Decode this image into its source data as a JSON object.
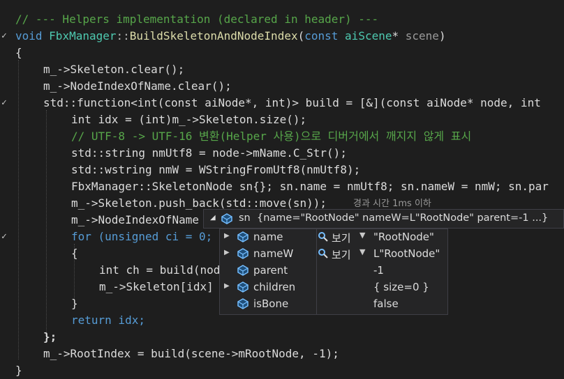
{
  "code": {
    "comment_helpers": "// --- Helpers implementation (declared in header) ---",
    "func_sig": {
      "void": "void",
      "cls": "FbxManager",
      "sep": "::",
      "fn": "BuildSkeletonAndNodeIndex",
      "p1": "(",
      "const": "const",
      "ty": "aiScene",
      "star": "*",
      "param": "scene",
      "p2": ")"
    },
    "lines": [
      "{",
      "m_->Skeleton.clear();",
      "m_->NodeIndexOfName.clear();",
      "std::function<int(const aiNode*, int)> build = [&](const aiNode* node, int",
      "int idx = (int)m_->Skeleton.size();",
      "// UTF-8 -> UTF-16 변환(Helper 사용)으로 디버거에서 깨지지 않게 표시",
      "std::string nmUtf8 = node->mName.C_Str();",
      "std::wstring nmW = WStringFromUtf8(nmUtf8);",
      "FbxManager::SkeletonNode sn{}; sn.name = nmUtf8; sn.nameW = nmW; sn.par",
      "m_->Skeleton.push_back(std::move(sn));",
      "m_->NodeIndexOfName",
      "for (unsigned ci = 0;",
      "{",
      "int ch = build(nod",
      "m_->Skeleton[idx]",
      "}",
      "return idx;",
      "};",
      "m_->RootIndex = build(scene->mRootNode, -1);",
      "}"
    ]
  },
  "perf_hint": "경과 시간 1ms 이하",
  "datatip": {
    "name": "sn",
    "value": "{name=\"RootNode\" nameW=L\"RootNode\" parent=-1 ...}",
    "rows": [
      {
        "name": "name",
        "expandable": true,
        "visualizer": "보기",
        "value": "\"RootNode\""
      },
      {
        "name": "nameW",
        "expandable": true,
        "visualizer": "보기",
        "value": "L\"RootNode\""
      },
      {
        "name": "parent",
        "expandable": false,
        "visualizer": "",
        "value": "-1"
      },
      {
        "name": "children",
        "expandable": true,
        "visualizer": "",
        "value": "{ size=0 }"
      },
      {
        "name": "isBone",
        "expandable": false,
        "visualizer": "",
        "value": "false"
      }
    ]
  },
  "icons": {
    "field": "field-icon",
    "magnifier": "magnifier-icon",
    "expand": "expand-arrow-icon",
    "collapse": "collapse-arrow-icon",
    "dropdown": "dropdown-icon"
  }
}
